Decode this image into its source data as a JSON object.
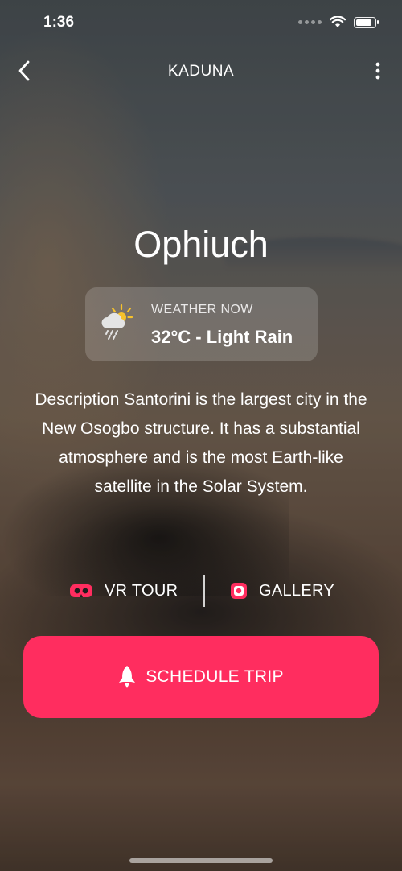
{
  "status_bar": {
    "time": "1:36",
    "icons": [
      "signal-dots-icon",
      "wifi-icon",
      "battery-icon"
    ],
    "battery_level": 0.85
  },
  "nav": {
    "title": "KADUNA",
    "back_icon": "chevron-left-icon",
    "more_icon": "more-vertical-icon"
  },
  "place": {
    "name": "Ophiuch"
  },
  "weather": {
    "label": "WEATHER NOW",
    "value": "32°C - Light Rain",
    "icon": "sun-rain-cloud-icon"
  },
  "description": "Description Santorini is the largest city in the New Osogbo structure. It has a substantial atmosphere and is the most Earth-like satellite in the Solar System.",
  "links": {
    "vr_tour": {
      "label": "VR TOUR",
      "icon": "vr-headset-icon"
    },
    "gallery": {
      "label": "GALLERY",
      "icon": "gallery-icon"
    }
  },
  "cta": {
    "label": "SCHEDULE TRIP",
    "icon": "rocket-icon"
  },
  "colors": {
    "accent": "#ff2d5f",
    "text": "#ffffff"
  }
}
